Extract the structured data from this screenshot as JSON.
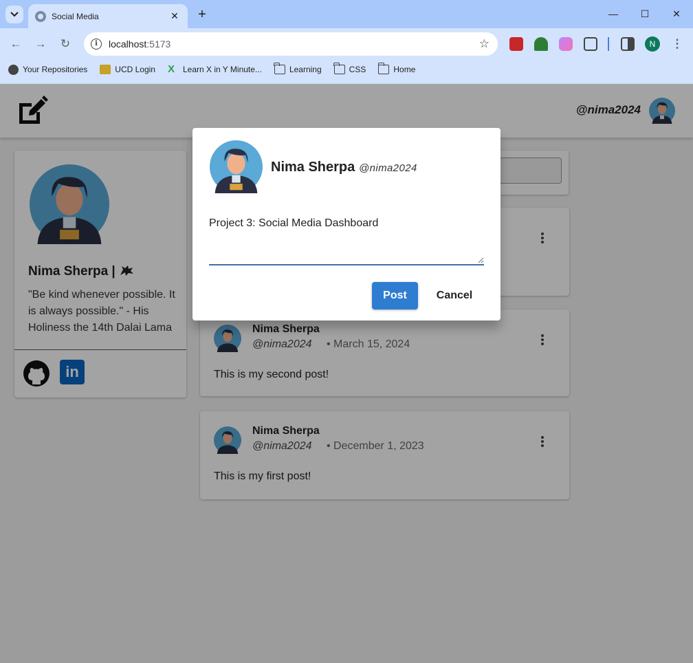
{
  "browser": {
    "tab_title": "Social Media",
    "url_host": "localhost",
    "url_port": ":5173",
    "profile_initial": "N",
    "bookmarks": [
      {
        "label": "Your Repositories"
      },
      {
        "label": "UCD Login"
      },
      {
        "label": "Learn X in Y Minute..."
      },
      {
        "label": "Learning"
      },
      {
        "label": "CSS"
      },
      {
        "label": "Home"
      }
    ]
  },
  "appbar": {
    "handle": "@nima2024"
  },
  "profile": {
    "name": "Nima Sherpa | ",
    "quote": "\"Be kind whenever possible. It is always possible.\" - His Holiness the 14th Dalai Lama",
    "linkedin_label": "in"
  },
  "posts": [
    {
      "name": "Nima Sherpa",
      "handle": "@nima2024",
      "date": "• March 15, 2024",
      "body": "This is my second post!"
    },
    {
      "name": "Nima Sherpa",
      "handle": "@nima2024",
      "date": "• December 1, 2023",
      "body": "This is my first post!"
    }
  ],
  "modal": {
    "name": "Nima Sherpa",
    "handle": "@nima2024",
    "text_value": "Project 3: Social Media Dashboard",
    "post_label": "Post",
    "cancel_label": "Cancel"
  },
  "colors": {
    "primary": "#2e7dd1",
    "linkedin": "#0a66c2",
    "chrome_tabstrip": "#a8c7fa",
    "chrome_toolbar": "#d3e3fd"
  }
}
